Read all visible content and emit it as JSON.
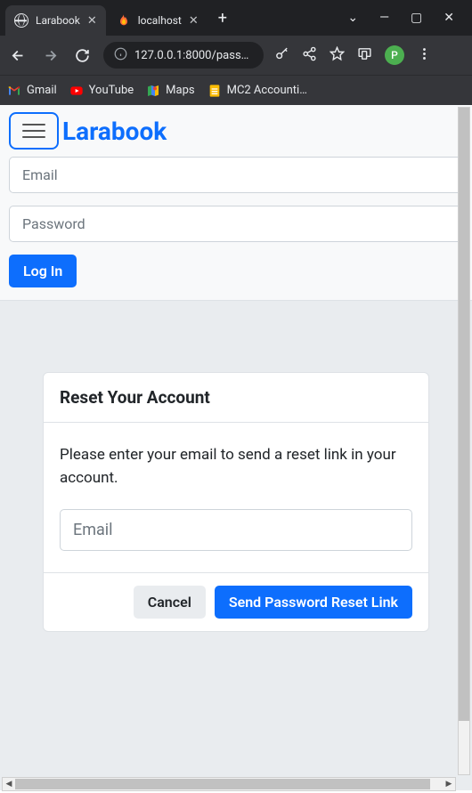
{
  "browser": {
    "tabs": [
      {
        "label": "Larabook",
        "icon": "globe"
      },
      {
        "label": "localhost",
        "icon": "flame"
      }
    ],
    "url": "127.0.0.1:8000/passw…",
    "window_controls": {
      "dropdown": "⌄",
      "minimize": "—",
      "maximize": "▢",
      "close": "✕"
    },
    "profile_letter": "P",
    "bookmarks": [
      {
        "label": "Gmail",
        "icon": "gmail"
      },
      {
        "label": "YouTube",
        "icon": "youtube"
      },
      {
        "label": "Maps",
        "icon": "maps"
      },
      {
        "label": "MC2 Accounti…",
        "icon": "sheets"
      }
    ]
  },
  "navbar": {
    "brand": "Larabook"
  },
  "login": {
    "email_placeholder": "Email",
    "password_placeholder": "Password",
    "submit_label": "Log In"
  },
  "reset_card": {
    "title": "Reset Your Account",
    "instruction": "Please enter your email to send a reset link in your account.",
    "email_placeholder": "Email",
    "cancel_label": "Cancel",
    "submit_label": "Send Password Reset Link"
  }
}
